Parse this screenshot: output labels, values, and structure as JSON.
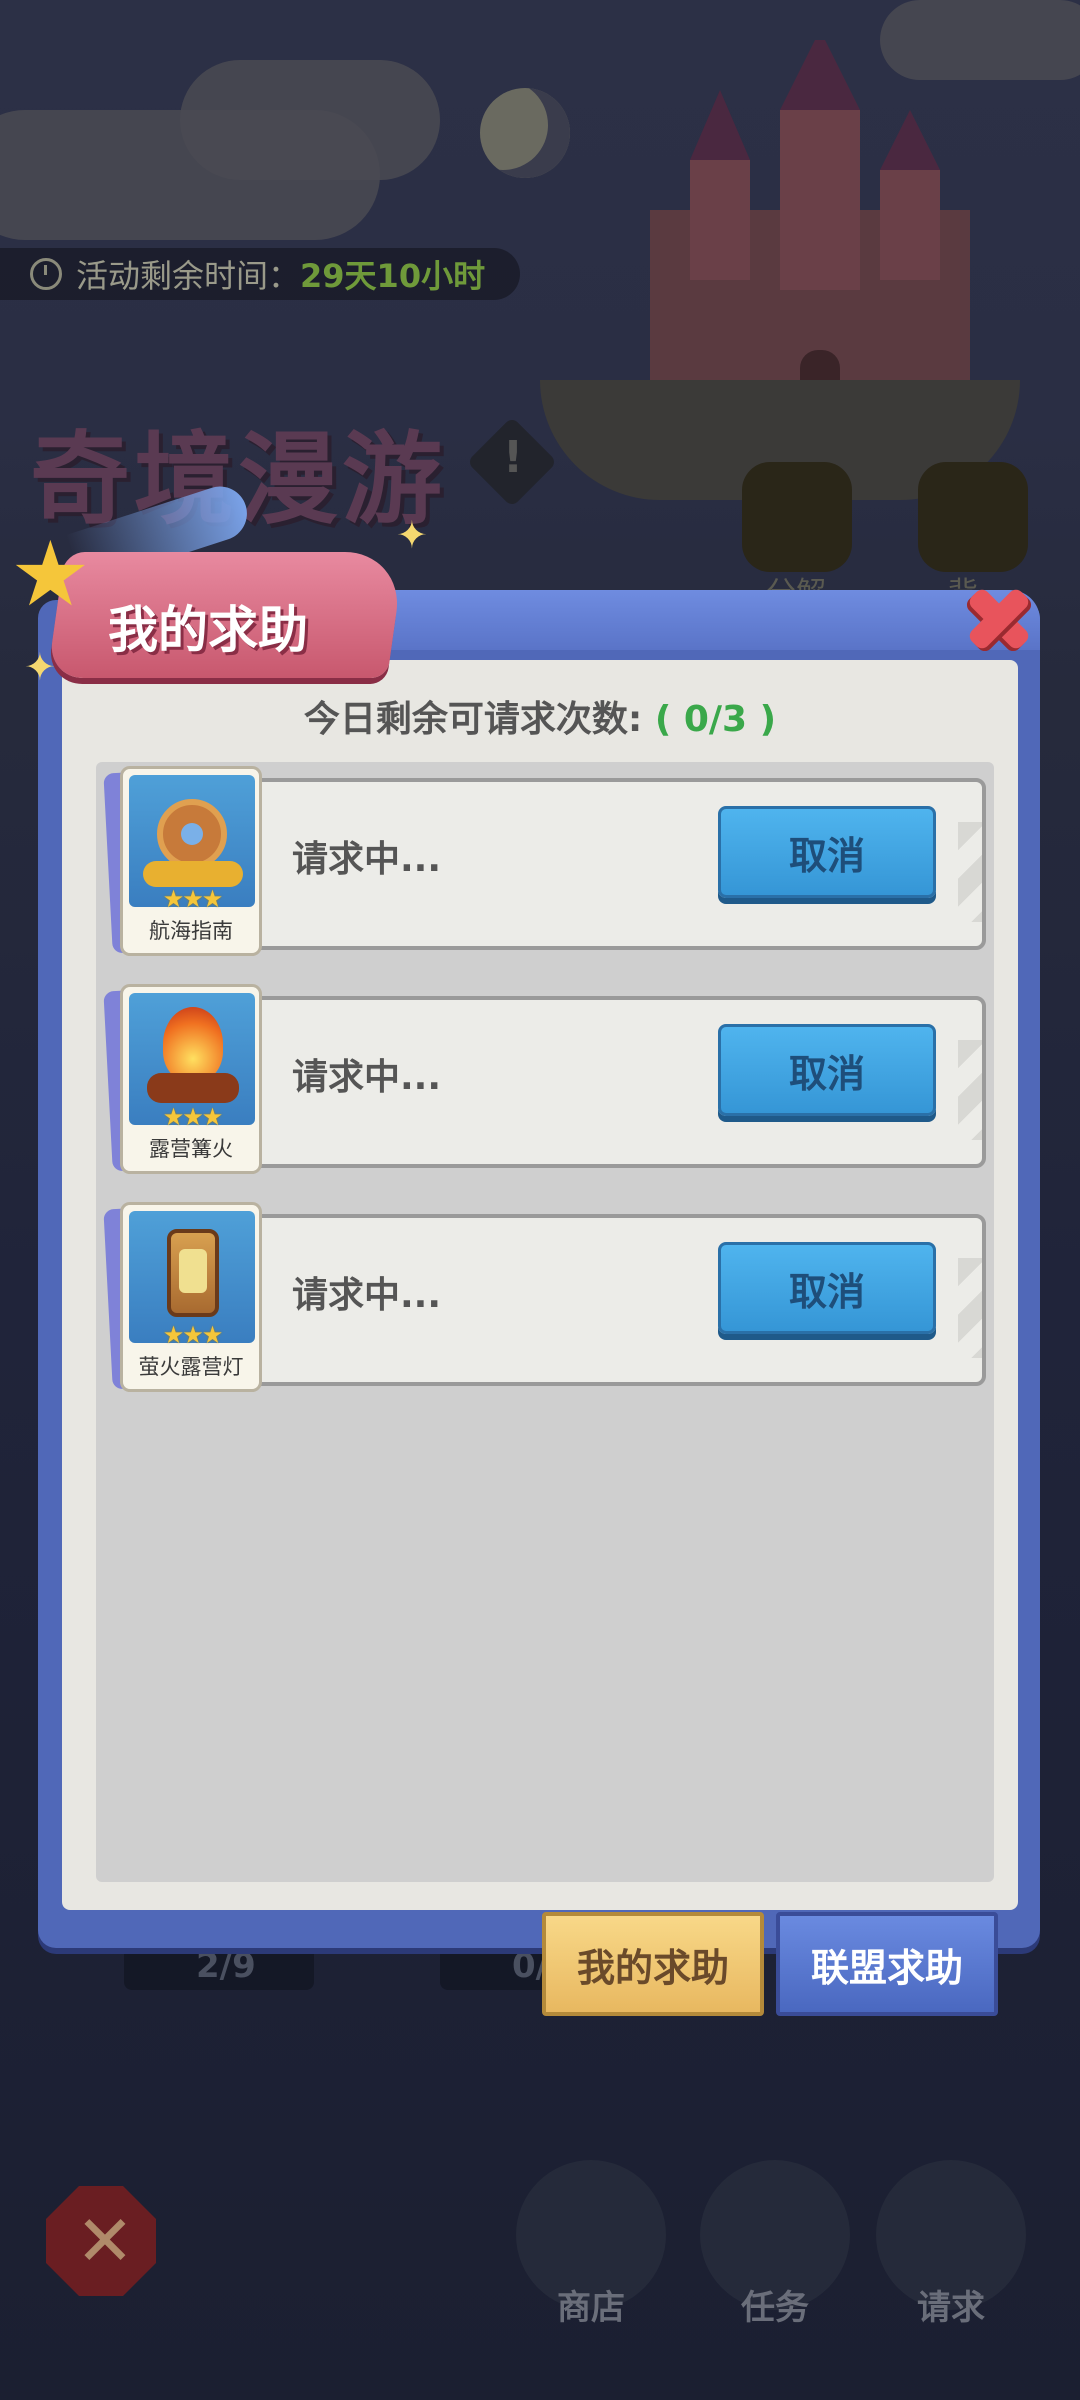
{
  "event": {
    "timer_label": "活动剩余时间：",
    "timer_value": "29天10小时",
    "title": "奇境漫游",
    "side_buttons": [
      "分解",
      "背"
    ]
  },
  "bottom_progress": [
    "2/9",
    "0/"
  ],
  "bottom_nav": [
    {
      "label": "商店",
      "icon": "shop-icon"
    },
    {
      "label": "任务",
      "icon": "task-clipboard-icon"
    },
    {
      "label": "请求",
      "icon": "bottle-icon"
    }
  ],
  "modal": {
    "title": "我的求助",
    "request_count_label": "今日剩余可请求次数:",
    "request_count_value": "( 0/3 )",
    "requests": [
      {
        "item_name": "航海指南",
        "stars": "★★★",
        "status": "请求中...",
        "action": "取消"
      },
      {
        "item_name": "露营篝火",
        "stars": "★★★",
        "status": "请求中...",
        "action": "取消"
      },
      {
        "item_name": "萤火露营灯",
        "stars": "★★★",
        "status": "请求中...",
        "action": "取消"
      }
    ],
    "tabs": {
      "my_help": "我的求助",
      "alliance_help": "联盟求助"
    }
  },
  "colors": {
    "accent_green": "#3aa84a",
    "cancel_button": "#3596d6",
    "modal_frame": "#5068b8",
    "ribbon": "#d8687e"
  }
}
